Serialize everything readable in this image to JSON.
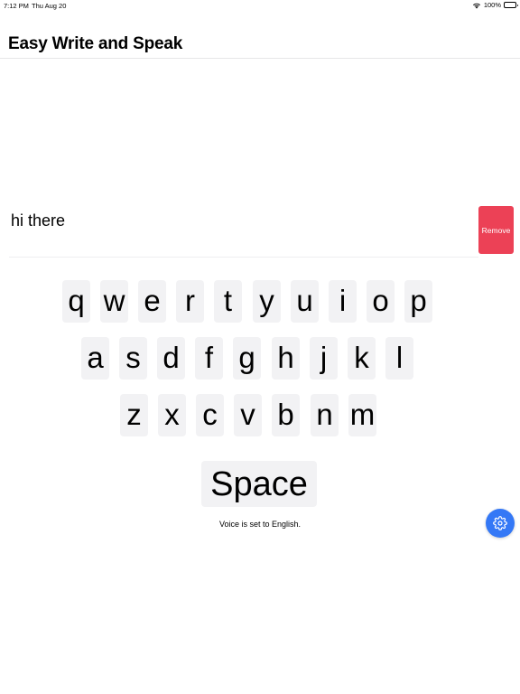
{
  "status_bar": {
    "time": "7:12 PM",
    "date": "Thu Aug 20",
    "battery": "100%",
    "battery_level": 1.0
  },
  "nav": {
    "title": "Easy Write and Speak"
  },
  "text_entry": {
    "value": "hi there",
    "remove_label": "Remove"
  },
  "keyboard": {
    "rows": [
      [
        "q",
        "w",
        "e",
        "r",
        "t",
        "y",
        "u",
        "i",
        "o",
        "p"
      ],
      [
        "a",
        "s",
        "d",
        "f",
        "g",
        "h",
        "j",
        "k",
        "l"
      ],
      [
        "z",
        "x",
        "c",
        "v",
        "b",
        "n",
        "m"
      ]
    ],
    "space_label": "Space"
  },
  "voice_status": "Voice is set to English.",
  "settings": {
    "icon": "gear-icon"
  },
  "colors": {
    "remove": "#ec4156",
    "accent": "#3478f6",
    "key_bg": "#f2f2f4"
  }
}
